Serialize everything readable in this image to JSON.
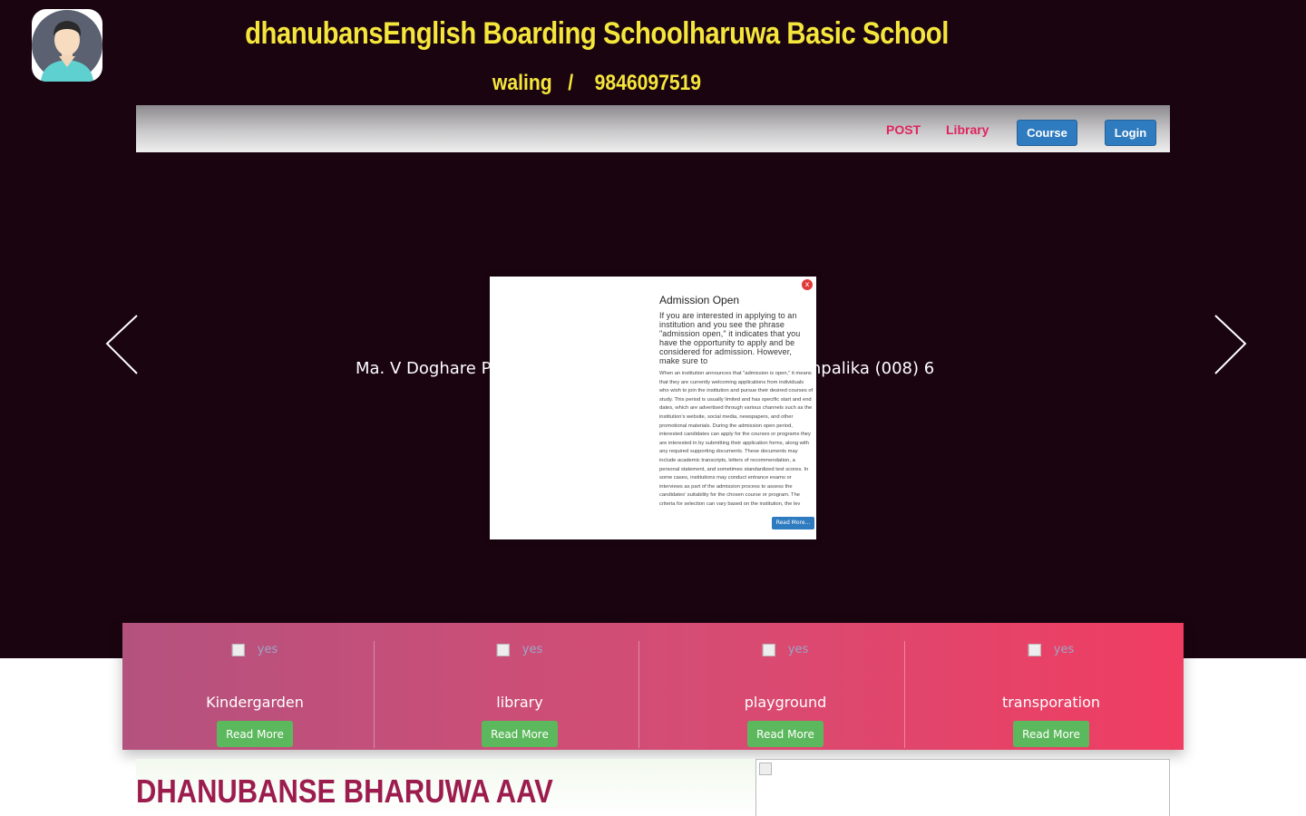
{
  "header": {
    "title": "dhanubansEnglish Boarding Schoolharuwa Basic School",
    "location": "waling",
    "separator": "/",
    "phone": "9846097519"
  },
  "nav": {
    "post": "POST",
    "library": "Library",
    "course": "Course",
    "login": "Login"
  },
  "slider": {
    "caption": "Ma. V Doghare Pr                                                      Gaunpalika (008) 6"
  },
  "popup": {
    "close_label": "x",
    "title": "Admission Open",
    "lead": "If you are interested in applying to an institution and you see the phrase \"admission open,\" it indicates that you have the opportunity to apply and be considered for admission. However, make sure to",
    "body": "When an institution announces that \"admission is open,\" it means that they are currently welcoming applications from individuals who wish to join the institution and pursue their desired courses of study. This period is usually limited and has specific start and end dates, which are advertised through various channels such as the institution's website, social media, newspapers, and other promotional materials. During the admission open period, interested candidates can apply for the courses or programs they are interested in by submitting their application forms, along with any required supporting documents. These documents may include academic transcripts, letters of recommendation, a personal statement, and sometimes standardized test scores. In some cases, institutions may conduct entrance exams or interviews as part of the admission process to assess the candidates' suitability for the chosen course or program. The criteria for selection can vary based on the institution, the lev",
    "read_more": "Read More..."
  },
  "services": [
    {
      "alt": "yes",
      "title": "Kindergarden",
      "button": "Read More"
    },
    {
      "alt": "yes",
      "title": "library",
      "button": "Read More"
    },
    {
      "alt": "yes",
      "title": "playground",
      "button": "Read More"
    },
    {
      "alt": "yes",
      "title": "transporation",
      "button": "Read More"
    }
  ],
  "section": {
    "title": "DHANUBANSE BHARUWA AAV"
  },
  "colors": {
    "hero_bg": "#1a0410",
    "title_yellow": "#f5e63c",
    "nav_link": "#e0245e",
    "button_blue": "#2f7bbf",
    "read_more_green": "#5cb85c",
    "section_title": "#9c1c4e"
  },
  "icons": {
    "avatar": "user-avatar-icon",
    "prev": "chevron-left-icon",
    "next": "chevron-right-icon",
    "close": "close-icon",
    "broken_image": "broken-image-icon"
  }
}
